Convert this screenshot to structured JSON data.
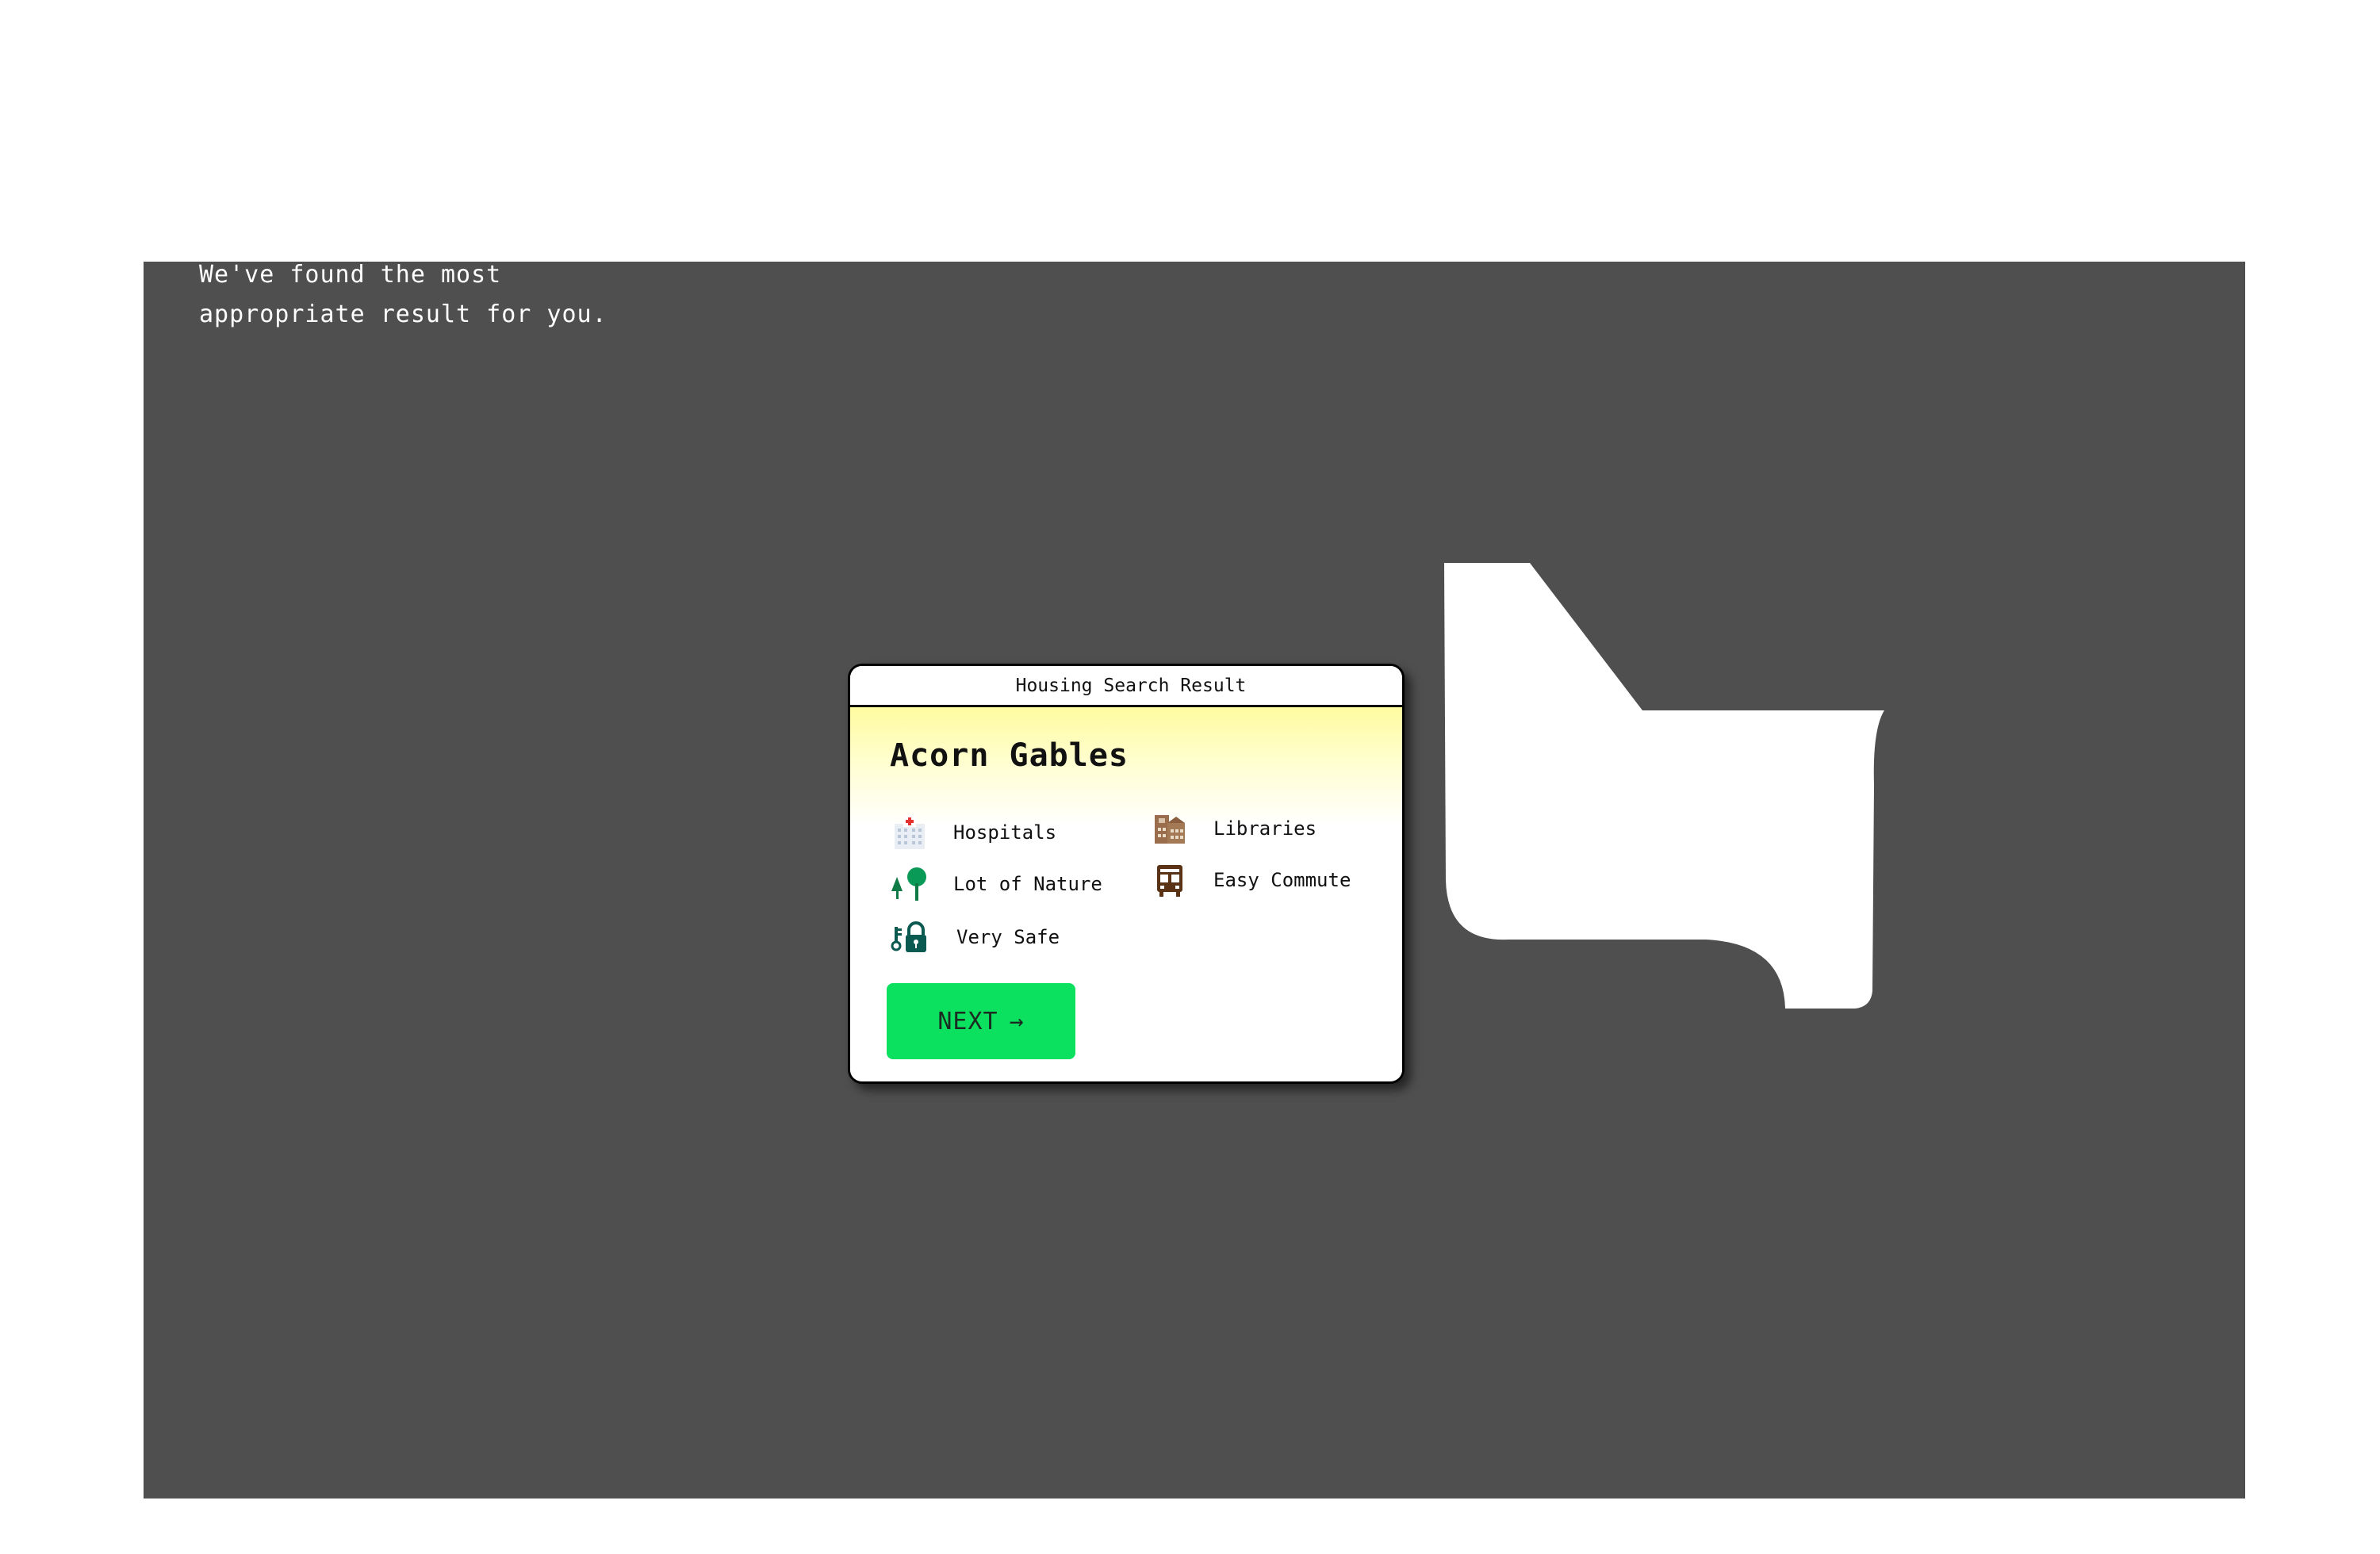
{
  "intro": {
    "line1": "We've found the most",
    "line2": "appropriate result for you."
  },
  "card": {
    "header": "Housing Search Result",
    "name": "Acorn Gables",
    "features": {
      "hospitals": {
        "label": "Hospitals",
        "icon": "hospital-icon"
      },
      "libraries": {
        "label": "Libraries",
        "icon": "library-building-icon"
      },
      "nature": {
        "label": "Lot of Nature",
        "icon": "trees-icon"
      },
      "commute": {
        "label": "Easy Commute",
        "icon": "bus-icon"
      },
      "safe": {
        "label": "Very Safe",
        "icon": "lock-key-icon"
      }
    },
    "next_button": {
      "label": "NEXT",
      "arrow": "→"
    }
  },
  "colors": {
    "stage_background": "#4f4f4f",
    "accent_button": "#0be05f",
    "card_gradient_top": "#fffca0"
  }
}
